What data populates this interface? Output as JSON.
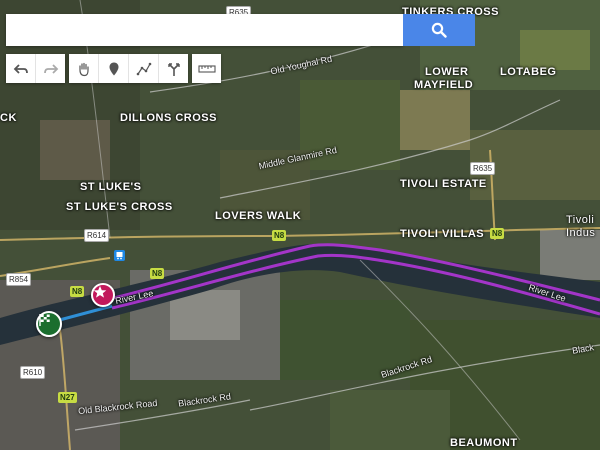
{
  "search": {
    "placeholder": ""
  },
  "toolbar": {
    "undo_icon": "undo-arrow-icon",
    "redo_icon": "redo-arrow-icon",
    "pan_icon": "hand-icon",
    "marker_icon": "map-pin-icon",
    "line_icon": "draw-line-icon",
    "route_icon": "directions-icon",
    "measure_icon": "ruler-icon"
  },
  "colors": {
    "search_button": "#4a86e8",
    "route_purple": "#a335c8",
    "route_blue": "#2f8fd6",
    "start_marker": "#c2185b",
    "end_marker": "#1b6e2e",
    "road_shield": "#c7dc43"
  },
  "labels": {
    "tinkers_cross": "TINKERS CROSS",
    "lower_mayfield_1": "LOWER",
    "lower_mayfield_2": "MAYFIELD",
    "lotabeg": "LOTABEG",
    "dillons_cross": "DILLONS CROSS",
    "st_lukes": "ST LUKE'S",
    "st_lukes_cross": "ST LUKE'S CROSS",
    "tivoli_estate": "TIVOLI ESTATE",
    "lovers_walk": "LOVERS WALK",
    "tivoli_villas": "TIVOLI VILLAS",
    "tivoli_indus_1": "Tivoli",
    "tivoli_indus_2": "Indus",
    "beaumont": "BEAUMONT",
    "left_edge": "CK"
  },
  "roads": {
    "old_youghal": "Old Youghal Rd",
    "middle_glanmire": "Middle Glanmire Rd",
    "blackrock_rd_1": "Blackrock Rd",
    "blackrock_rd_2": "Blackrock Rd",
    "blackrock_rd_edge": "Black",
    "old_blackrock": "Old Blackrock Road",
    "river_lee_1": "River Lee",
    "river_lee_2": "River Lee"
  },
  "shields": {
    "r635_top": "R635",
    "r635_mid": "R635",
    "r614": "R614",
    "r854": "R854",
    "r610": "R610",
    "n8_a": "N8",
    "n8_b": "N8",
    "n8_c": "N8",
    "n8_d": "N8",
    "n27": "N27"
  }
}
